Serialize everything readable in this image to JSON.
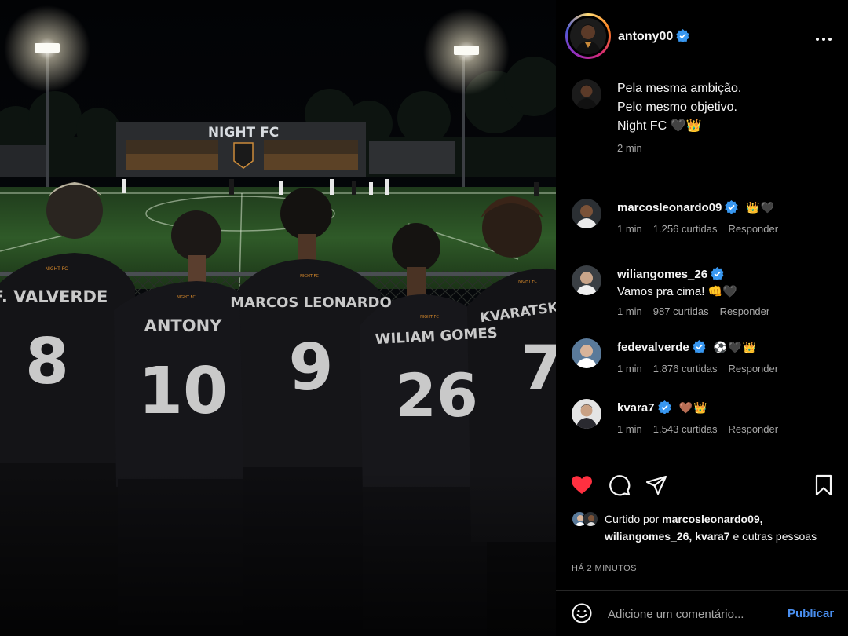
{
  "post": {
    "image": {
      "stadium_sign": "NIGHT FC",
      "shirt_badge": "NIGHT FC",
      "players": [
        {
          "name": "F. VALVERDE",
          "number": "8"
        },
        {
          "name": "ANTONY",
          "number": "10"
        },
        {
          "name": "MARCOS LEONARDO",
          "number": "9"
        },
        {
          "name": "WILIAM GOMES",
          "number": "26"
        },
        {
          "name": "KVARATSKHI",
          "number": "7"
        }
      ]
    },
    "author": {
      "username": "antony00",
      "verified": true
    },
    "caption_lines": [
      "Pela mesma ambição.",
      "Pelo mesmo objetivo.",
      "Night FC 🖤👑"
    ],
    "caption_time": "2 min",
    "comments": [
      {
        "username": "marcosleonardo09",
        "verified": true,
        "inline": "👑🖤",
        "text": "",
        "time": "1 min",
        "likes": "1.256 curtidas",
        "reply": "Responder"
      },
      {
        "username": "wiliangomes_26",
        "verified": true,
        "inline": "",
        "text": "Vamos pra cima! 👊🖤",
        "time": "1 min",
        "likes": "987 curtidas",
        "reply": "Responder"
      },
      {
        "username": "fedevalverde",
        "verified": true,
        "inline": "⚽🖤👑",
        "text": "",
        "time": "1 min",
        "likes": "1.876 curtidas",
        "reply": "Responder"
      },
      {
        "username": "kvara7",
        "verified": true,
        "inline": "🤎👑",
        "text": "",
        "time": "1 min",
        "likes": "1.543 curtidas",
        "reply": "Responder"
      }
    ],
    "actions": {
      "like_icon": "heart-filled-icon",
      "comment_icon": "comment-icon",
      "share_icon": "send-icon",
      "save_icon": "bookmark-icon",
      "liked": true
    },
    "liked_by": {
      "prefix": "Curtido por",
      "user1": "marcosleonardo09,",
      "user2": "wiliangomes_26,",
      "user3": "kvara7",
      "suffix": "e outras pessoas"
    },
    "timestamp": "HÁ 2 MINUTOS",
    "add_comment": {
      "placeholder": "Adicione um comentário...",
      "publish": "Publicar",
      "emoji_icon": "smiley-icon"
    }
  },
  "colors": {
    "background": "#000000",
    "text": "#f5f5f5",
    "muted": "#a8a8a8",
    "like": "#ff3040",
    "verified": "#3897f0",
    "publish": "#4a8ff0"
  }
}
